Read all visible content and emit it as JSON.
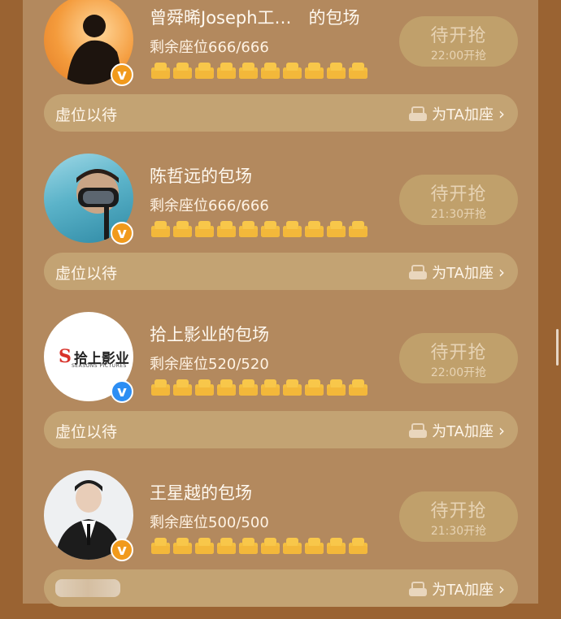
{
  "cards": [
    {
      "title": "曾舜晞Joseph工…　的包场",
      "seats_text": "剩余座位666/666",
      "badge": "v",
      "button_main": "待开抢",
      "button_sub": "22:00开抢",
      "bar_left": "虚位以待",
      "bar_right": "为TA加座"
    },
    {
      "title": "陈哲远的包场",
      "seats_text": "剩余座位666/666",
      "badge": "v",
      "button_main": "待开抢",
      "button_sub": "21:30开抢",
      "bar_left": "虚位以待",
      "bar_right": "为TA加座"
    },
    {
      "title": "拾上影业的包场",
      "seats_text": "剩余座位520/520",
      "badge": "v",
      "logo_text": "拾上影业",
      "logo_sub": "SEASONS PICTURES",
      "button_main": "待开抢",
      "button_sub": "22:00开抢",
      "bar_left": "虚位以待",
      "bar_right": "为TA加座"
    },
    {
      "title": "王星越的包场",
      "seats_text": "剩余座位500/500",
      "badge": "v",
      "button_main": "待开抢",
      "button_sub": "21:30开抢",
      "bar_right": "为TA加座"
    }
  ],
  "colors": {
    "background": "#9a6332",
    "panel": "#b3895e",
    "seat": "#f8c74a",
    "badge_orange": "#f19a1c",
    "badge_blue": "#2d8ef3"
  }
}
